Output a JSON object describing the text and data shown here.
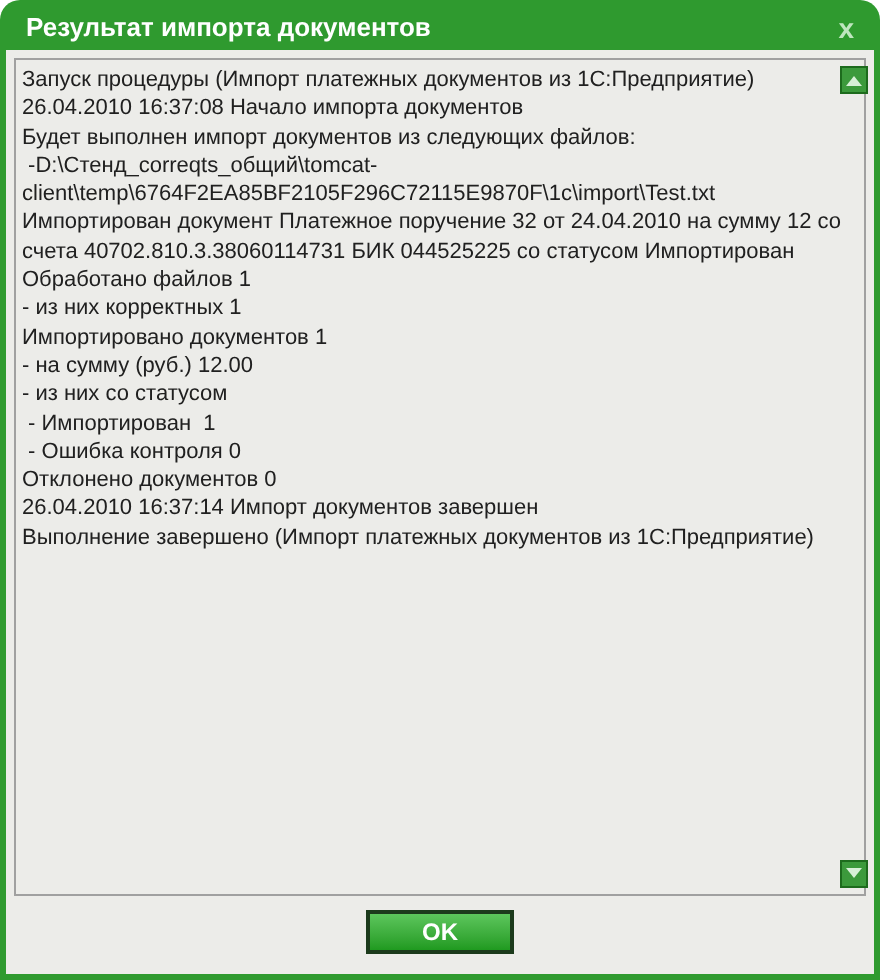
{
  "window": {
    "title": "Результат импорта документов",
    "close": "x"
  },
  "log": {
    "lines": [
      "Запуск процедуры (Импорт платежных документов из 1С:Предприятие)",
      "26.04.2010 16:37:08 Начало импорта документов",
      "Будет выполнен импорт документов из следующих файлов:",
      " -D:\\Стенд_correqts_общий\\tomcat-",
      "client\\temp\\6764F2EA85BF2105F296C72115E9870F\\1c\\import\\Test.txt",
      "Импортирован документ Платежное поручение 32 от 24.04.2010 на сумму 12 со",
      "счета 40702.810.3.38060114731 БИК 044525225 со статусом Импортирован",
      "Обработано файлов 1",
      "- из них корректных 1",
      "Импортировано документов 1",
      "- на сумму (руб.) 12.00",
      "- из них со статусом",
      " - Импортирован  1",
      " - Ошибка контроля 0",
      "Отклонено документов 0",
      "26.04.2010 16:37:14 Импорт документов завершен",
      "Выполнение завершено (Импорт платежных документов из 1С:Предприятие)"
    ]
  },
  "buttons": [
    {
      "label": "OK"
    }
  ]
}
